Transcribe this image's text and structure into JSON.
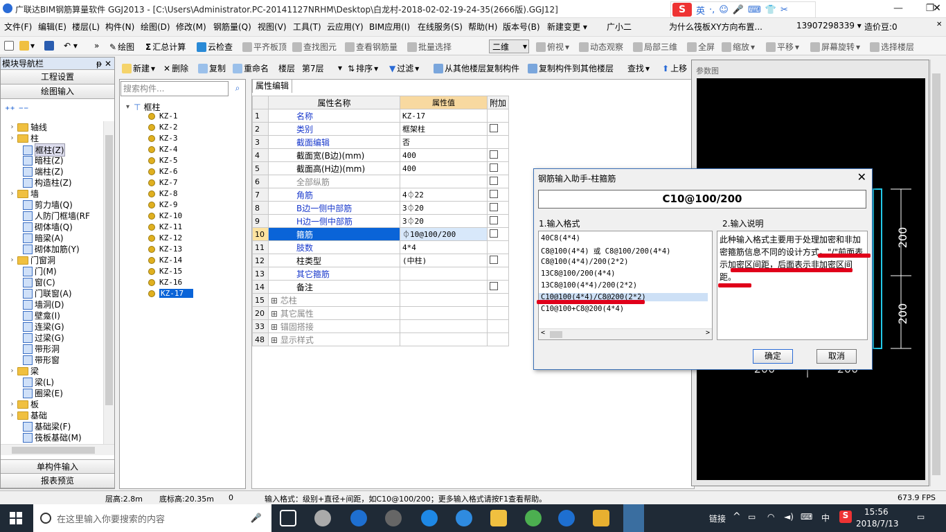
{
  "window": {
    "title": "广联达BIM钢筋算量软件 GGJ2013 - [C:\\Users\\Administrator.PC-20141127NRHM\\Desktop\\白龙村-2018-02-02-19-24-35(2666版).GGJ12]"
  },
  "ime": {
    "label": "英"
  },
  "menu": {
    "items": [
      "文件(F)",
      "编辑(E)",
      "楼层(L)",
      "构件(N)",
      "绘图(D)",
      "修改(M)",
      "钢筋量(Q)",
      "视图(V)",
      "工具(T)",
      "云应用(Y)",
      "BIM应用(I)",
      "在线服务(S)",
      "帮助(H)",
      "版本号(B)",
      "新建变更 ▾",
      "广小二"
    ],
    "promo": "为什么筏板XY方向布置...",
    "phone": "13907298339 ▾",
    "coins": "造价豆:0"
  },
  "toolbar1": {
    "draw": "绘图",
    "sum": "汇总计算",
    "cloud_check": "云检查",
    "flat_top": "平齐板顶",
    "find": "查找图元",
    "view_steel": "查看钢筋量",
    "batch": "批量选择",
    "view_mode": "二维",
    "top_view": "俯视",
    "dyn_view": "动态观察",
    "local3d": "局部三维",
    "fullscreen": "全屏",
    "zoom": "缩放",
    "pan": "平移",
    "rotate": "屏幕旋转",
    "select_layer": "选择楼层"
  },
  "nav": {
    "header": "模块导航栏",
    "project_settings": "工程设置",
    "draw_input": "绘图输入",
    "single_input": "单构件输入",
    "report": "报表预览",
    "tree": [
      {
        "label": "轴线",
        "type": "folder"
      },
      {
        "label": "柱",
        "type": "folder"
      },
      {
        "label": "框柱(Z)",
        "type": "leaf"
      },
      {
        "label": "暗柱(Z)",
        "type": "leaf"
      },
      {
        "label": "端柱(Z)",
        "type": "leaf"
      },
      {
        "label": "构造柱(Z)",
        "type": "leaf"
      },
      {
        "label": "墙",
        "type": "folder"
      },
      {
        "label": "剪力墙(Q)",
        "type": "leaf"
      },
      {
        "label": "人防门框墙(RF",
        "type": "leaf"
      },
      {
        "label": "砌体墙(Q)",
        "type": "leaf"
      },
      {
        "label": "暗梁(A)",
        "type": "leaf"
      },
      {
        "label": "砌体加筋(Y)",
        "type": "leaf"
      },
      {
        "label": "门窗洞",
        "type": "folder"
      },
      {
        "label": "门(M)",
        "type": "leaf"
      },
      {
        "label": "窗(C)",
        "type": "leaf"
      },
      {
        "label": "门联窗(A)",
        "type": "leaf"
      },
      {
        "label": "墙洞(D)",
        "type": "leaf"
      },
      {
        "label": "壁龛(I)",
        "type": "leaf"
      },
      {
        "label": "连梁(G)",
        "type": "leaf"
      },
      {
        "label": "过梁(G)",
        "type": "leaf"
      },
      {
        "label": "带形洞",
        "type": "leaf"
      },
      {
        "label": "带形窗",
        "type": "leaf"
      },
      {
        "label": "梁",
        "type": "folder"
      },
      {
        "label": "梁(L)",
        "type": "leaf"
      },
      {
        "label": "圈梁(E)",
        "type": "leaf"
      },
      {
        "label": "板",
        "type": "folder"
      },
      {
        "label": "基础",
        "type": "folder"
      },
      {
        "label": "基础梁(F)",
        "type": "leaf"
      },
      {
        "label": "筏板基础(M)",
        "type": "leaf"
      }
    ]
  },
  "toolbar2": {
    "new": "新建",
    "delete": "删除",
    "copy": "复制",
    "rename": "重命名",
    "floor_label": "楼层",
    "floor_value": "第7层",
    "sort": "排序",
    "filter": "过滤",
    "copy_from": "从其他楼层复制构件",
    "copy_to": "复制构件到其他楼层",
    "find": "查找",
    "up": "上移"
  },
  "complist": {
    "search_placeholder": "搜索构件...",
    "root": "框柱",
    "items": [
      "KZ-1",
      "KZ-2",
      "KZ-3",
      "KZ-4",
      "KZ-5",
      "KZ-6",
      "KZ-7",
      "KZ-8",
      "KZ-9",
      "KZ-10",
      "KZ-11",
      "KZ-12",
      "KZ-13",
      "KZ-14",
      "KZ-15",
      "KZ-16",
      "KZ-17"
    ],
    "selected": "KZ-17"
  },
  "props": {
    "tab": "属性编辑",
    "col_name": "属性名称",
    "col_value": "属性值",
    "col_extra": "附加",
    "rows": [
      {
        "n": "1",
        "name": "名称",
        "value": "KZ-17",
        "cb": false,
        "blue": true
      },
      {
        "n": "2",
        "name": "类别",
        "value": "框架柱",
        "cb": true,
        "blue": true
      },
      {
        "n": "3",
        "name": "截面编辑",
        "value": "否",
        "cb": false,
        "blue": true
      },
      {
        "n": "4",
        "name": "截面宽(B边)(mm)",
        "value": "400",
        "cb": true,
        "blue": false
      },
      {
        "n": "5",
        "name": "截面高(H边)(mm)",
        "value": "400",
        "cb": true,
        "blue": false
      },
      {
        "n": "6",
        "name": "全部纵筋",
        "value": "",
        "cb": true,
        "gray": true
      },
      {
        "n": "7",
        "name": "角筋",
        "value": "4⏀22",
        "cb": true,
        "blue": true
      },
      {
        "n": "8",
        "name": "B边一侧中部筋",
        "value": "3⏀20",
        "cb": true,
        "blue": true
      },
      {
        "n": "9",
        "name": "H边一侧中部筋",
        "value": "3⏀20",
        "cb": true,
        "blue": true
      },
      {
        "n": "10",
        "name": "箍筋",
        "value": "⏀10@100/200",
        "cb": true,
        "blue": true,
        "sel": true
      },
      {
        "n": "11",
        "name": "肢数",
        "value": "4*4",
        "cb": false,
        "blue": true
      },
      {
        "n": "12",
        "name": "柱类型",
        "value": "(中柱)",
        "cb": true,
        "blue": false
      },
      {
        "n": "13",
        "name": "其它箍筋",
        "value": "",
        "cb": false,
        "blue": true
      },
      {
        "n": "14",
        "name": "备注",
        "value": "",
        "cb": true,
        "blue": false
      },
      {
        "n": "15",
        "name": "芯柱",
        "value": "",
        "exp": true,
        "gray": true
      },
      {
        "n": "20",
        "name": "其它属性",
        "value": "",
        "exp": true,
        "gray": true
      },
      {
        "n": "33",
        "name": "锚固搭接",
        "value": "",
        "exp": true,
        "gray": true
      },
      {
        "n": "48",
        "name": "显示样式",
        "value": "",
        "exp": true,
        "gray": true
      }
    ]
  },
  "refpanel": {
    "title": "参数图",
    "dim1": "200",
    "dim2": "200",
    "dim3": "200",
    "dim4": "200"
  },
  "dialog": {
    "title": "钢筋输入助手-柱箍筋",
    "input_value": "C10@100/200",
    "fmt_label": "1.输入格式",
    "desc_label": "2.输入说明",
    "formats": [
      "40C8(4*4)",
      "C8@100(4*4) 或 C8@100/200(4*4)",
      "C8@100(4*4)/200(2*2)",
      "13C8@100/200(4*4)",
      "13C8@100(4*4)/200(2*2)",
      "C10@100(4*4)/C8@200(2*2)",
      "C10@100+C8@200(4*4)"
    ],
    "selected_format": "C10@100(4*4)/C8@200(2*2)",
    "description": "此种输入格式主要用于处理加密和非加密箍筋信息不同的设计方式。\"/\"前面表示加密区间距，后面表示非加密区间距。",
    "ok": "确定",
    "cancel": "取消"
  },
  "status": {
    "floor_height": "层高:2.8m",
    "bottom_elev": "底标高:20.35m",
    "zero": "0",
    "hint": "输入格式：级别+直径+间距，如C10@100/200；更多输入格式请按F1查看帮助。",
    "fps": "673.9 FPS"
  },
  "taskbar": {
    "search_placeholder": "在这里输入你要搜索的内容",
    "link": "链接",
    "lang": "中",
    "time": "15:56",
    "date": "2018/7/13"
  }
}
